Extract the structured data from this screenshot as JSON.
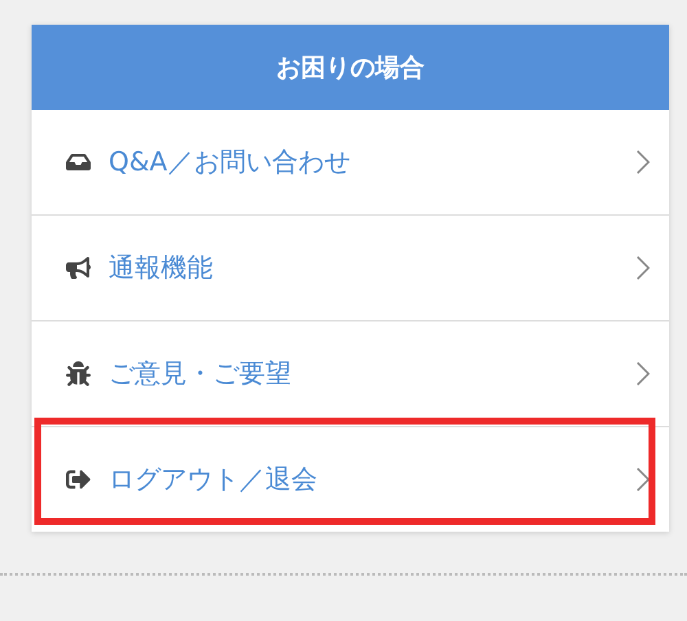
{
  "panel": {
    "title": "お困りの場合"
  },
  "items": [
    {
      "label": "Q&A／お問い合わせ",
      "highlighted": false
    },
    {
      "label": "通報機能",
      "highlighted": false
    },
    {
      "label": "ご意見・ご要望",
      "highlighted": false
    },
    {
      "label": "ログアウト／退会",
      "highlighted": true
    }
  ]
}
